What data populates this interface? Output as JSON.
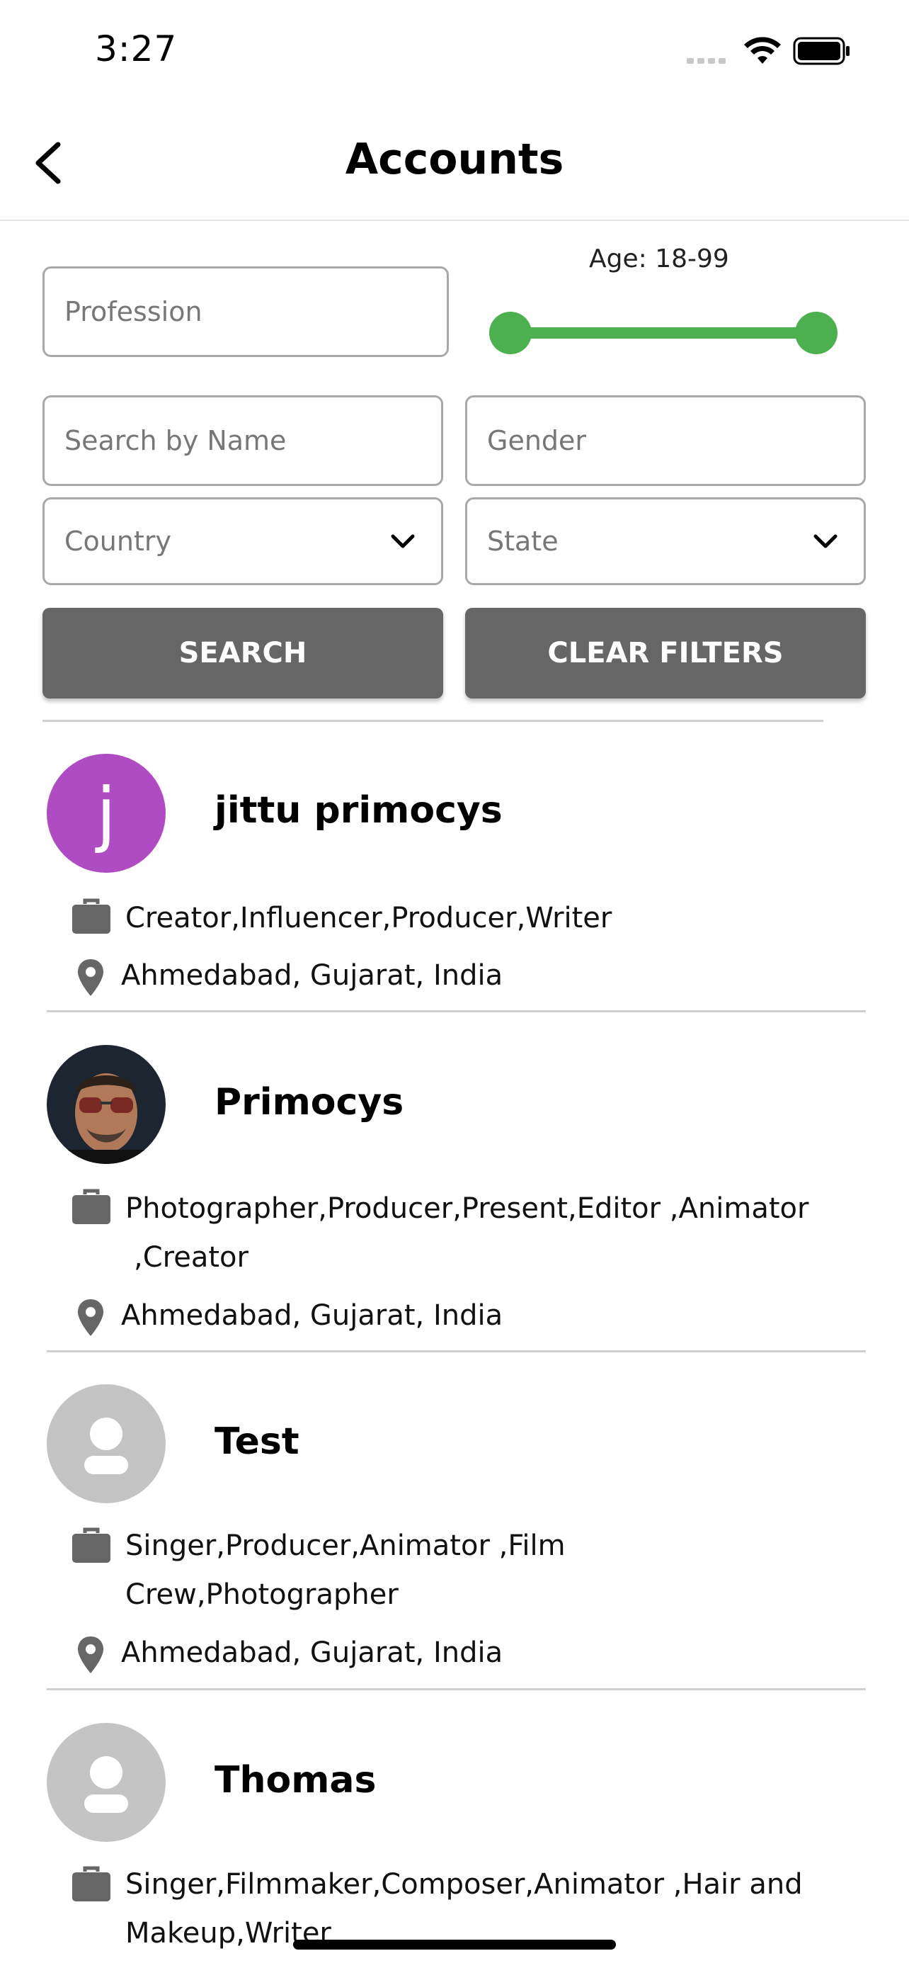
{
  "status": {
    "time": "3:27"
  },
  "header": {
    "title": "Accounts"
  },
  "filters": {
    "profession_placeholder": "Profession",
    "age_label": "Age:  18-99",
    "age_min": 18,
    "age_max": 99,
    "name_placeholder": "Search by Name",
    "gender_placeholder": "Gender",
    "country_placeholder": "Country",
    "state_placeholder": "State",
    "search_label": "SEARCH",
    "clear_label": "CLEAR FILTERS"
  },
  "accounts": [
    {
      "name": "jittu primocys",
      "avatar_letter": "j",
      "professions": "Creator,Influencer,Producer,Writer",
      "location": "Ahmedabad, Gujarat, India"
    },
    {
      "name": "Primocys",
      "professions_line1": "Photographer,Producer,Present,Editor ,Animator",
      "professions_line2": ",Creator",
      "location": "Ahmedabad, Gujarat, India"
    },
    {
      "name": "Test",
      "professions_line1": "Singer,Producer,Animator ,Film",
      "professions_line2": "Crew,Photographer",
      "location": "Ahmedabad, Gujarat, India"
    },
    {
      "name": "Thomas",
      "professions_line1": "Singer,Filmmaker,Composer,Animator ,Hair and",
      "professions_line2": "Makeup,Writer"
    }
  ],
  "colors": {
    "accent": "#4caf50",
    "button": "#666666",
    "avatar_j": "#b04cc3"
  }
}
